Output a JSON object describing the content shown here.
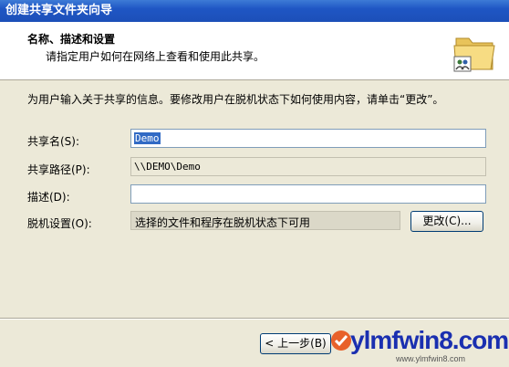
{
  "window": {
    "title": "创建共享文件夹向导"
  },
  "header": {
    "title": "名称、描述和设置",
    "subtitle": "请指定用户如何在网络上查看和使用此共享。",
    "icon": "shared-folder-icon"
  },
  "intro": "为用户输入关于共享的信息。要修改用户在脱机状态下如何使用内容，请单击“更改”。",
  "form": {
    "share_name_label": "共享名(S):",
    "share_name_value": "Demo",
    "share_path_label": "共享路径(P):",
    "share_path_value": "\\\\DEMO\\Demo",
    "description_label": "描述(D):",
    "description_value": "",
    "offline_label": "脱机设置(O):",
    "offline_value": "选择的文件和程序在脱机状态下可用",
    "change_button": "更改(C)..."
  },
  "footer": {
    "back_button": "< 上一步(B)"
  },
  "watermark": {
    "text": "ylmfwin8.com",
    "url": "www.ylmfwin8.com"
  },
  "colors": {
    "titlebar": "#1f56c4",
    "dialog_bg": "#ece9d8",
    "selection": "#316ac5"
  }
}
